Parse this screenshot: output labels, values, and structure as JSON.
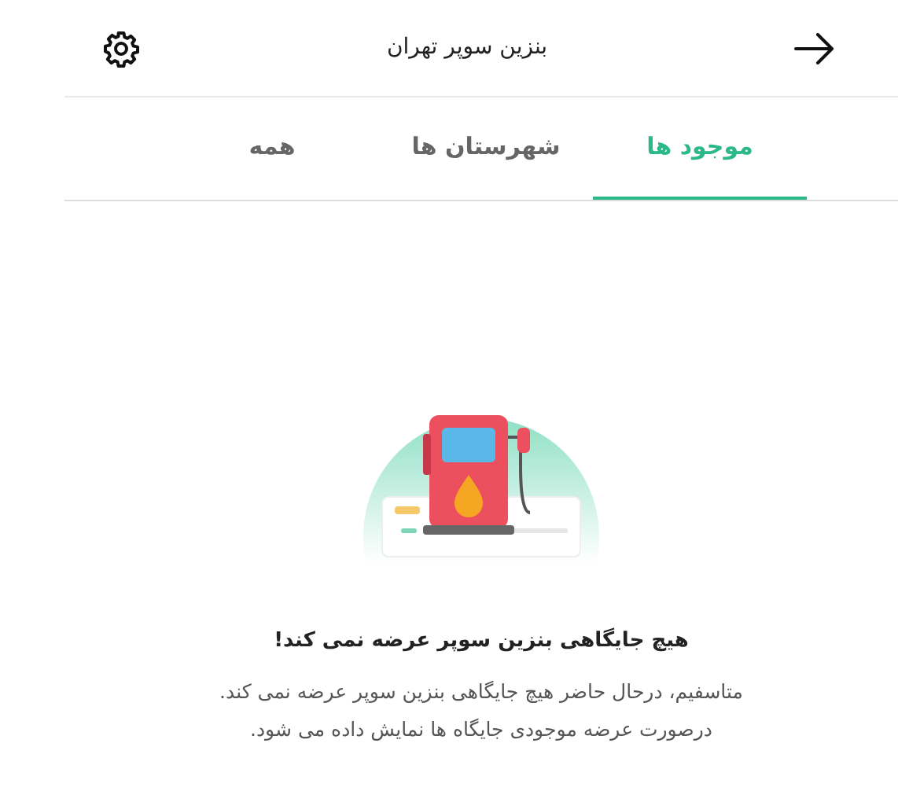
{
  "header": {
    "title": "بنزین سوپر تهران"
  },
  "tabs": [
    {
      "label": "موجود ها",
      "selected": true
    },
    {
      "label": "شهرستان ها",
      "selected": false
    },
    {
      "label": "همه",
      "selected": false
    }
  ],
  "empty_state": {
    "title": "هیچ جایگاهی بنزین سوپر عرضه نمی کند!",
    "lines": [
      "متاسفیم، درحال حاضر هیچ جایگاهی بنزین سوپر عرضه نمی کند.",
      "درصورت عرضه موجودی جایگاه ها نمایش داده می شود."
    ]
  }
}
